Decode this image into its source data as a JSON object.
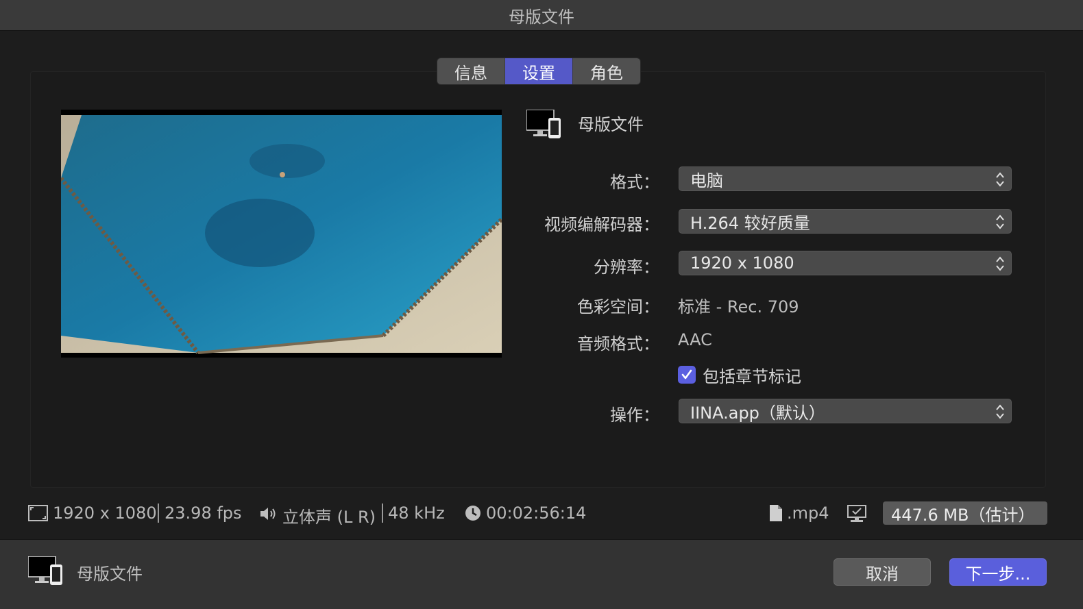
{
  "window": {
    "title": "母版文件"
  },
  "tabs": [
    {
      "label": "信息"
    },
    {
      "label": "设置"
    },
    {
      "label": "角色"
    }
  ],
  "header": {
    "title": "母版文件"
  },
  "settings": {
    "format_label": "格式：",
    "format_value": "电脑",
    "codec_label": "视频编解码器：",
    "codec_value": "H.264 较好质量",
    "resolution_label": "分辨率：",
    "resolution_value": "1920 x 1080",
    "colorspace_label": "色彩空间：",
    "colorspace_value": "标准 - Rec. 709",
    "audio_label": "音频格式：",
    "audio_value": "AAC",
    "chapters_label": "包括章节标记",
    "chapters_checked": true,
    "action_label": "操作：",
    "action_value": "IINA.app（默认）"
  },
  "status": {
    "dimensions": "1920 x 1080",
    "fps": "23.98 fps",
    "audio": "立体声 (L R)",
    "sample_rate": "48 kHz",
    "duration": "00:02:56:14",
    "extension": ".mp4",
    "size": "447.6 MB（估计）"
  },
  "footer": {
    "title": "母版文件",
    "cancel": "取消",
    "next": "下一步..."
  },
  "colors": {
    "accent": "#5559c8",
    "background": "#1d1d1d"
  }
}
